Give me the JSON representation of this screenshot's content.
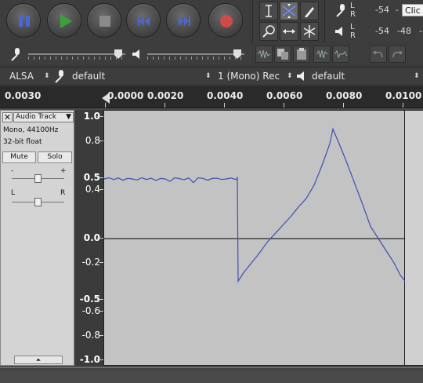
{
  "transport": {
    "buttons": [
      {
        "name": "pause-button",
        "icon": "pause-icon",
        "color": "#4a67d0"
      },
      {
        "name": "play-button",
        "icon": "play-icon",
        "color": "#3aa13a"
      },
      {
        "name": "stop-button",
        "icon": "stop-icon",
        "color": "#8a8a8a"
      },
      {
        "name": "skip-to-start-button",
        "icon": "skip-start-icon",
        "color": "#4a67d0"
      },
      {
        "name": "skip-to-end-button",
        "icon": "skip-end-icon",
        "color": "#4a67d0"
      },
      {
        "name": "record-button",
        "icon": "record-icon",
        "color": "#d04a4a"
      }
    ]
  },
  "tools": [
    "selection-tool",
    "envelope-tool",
    "draw-tool",
    "zoom-tool",
    "time-shift-tool",
    "multi-tool"
  ],
  "meters": {
    "record": {
      "l": "L",
      "r": "R",
      "scale": [
        "-54",
        "-"
      ],
      "hint": "Clic"
    },
    "playback": {
      "l": "L",
      "r": "R",
      "scale": [
        "-54",
        "-48",
        "-"
      ]
    }
  },
  "device": {
    "host": "ALSA",
    "recording_device": "default",
    "channels": "1 (Mono) Rec",
    "playback_device": "default"
  },
  "timeline": {
    "labels": [
      "0.0030",
      "0.0000",
      "0.0020",
      "0.0040",
      "0.0060",
      "0.0080",
      "0.0100"
    ]
  },
  "track": {
    "name": "Audio Track",
    "info_rate": "Mono, 44100Hz",
    "info_format": "32-bit float",
    "mute_label": "Mute",
    "solo_label": "Solo",
    "gain_minus": "-",
    "gain_plus": "+",
    "pan_left": "L",
    "pan_right": "R",
    "gain_level": 0.5,
    "pan_level": 0.5
  },
  "vertical_ruler": {
    "labels": [
      {
        "text": "1.0",
        "major": true
      },
      {
        "text": "0.8",
        "major": false
      },
      {
        "text": "0.5",
        "major": true
      },
      {
        "text": "0.4",
        "major": false
      },
      {
        "text": "0.0",
        "major": true
      },
      {
        "text": "-0.2",
        "major": false
      },
      {
        "text": "-0.5",
        "major": true
      },
      {
        "text": "-0.6",
        "major": false
      },
      {
        "text": "-0.8",
        "major": false
      },
      {
        "text": "-1.0",
        "major": true
      }
    ]
  },
  "colors": {
    "waveform": "#3f4fb0",
    "zero_line": "#000000",
    "wave_background": "#c3c3c3"
  }
}
